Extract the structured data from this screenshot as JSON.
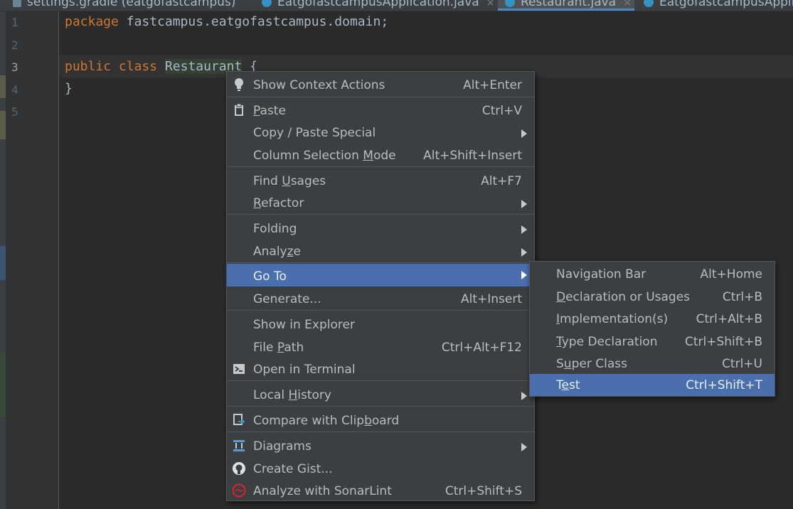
{
  "tabs": [
    {
      "label": "settings.gradle (eatgofastcampus)"
    },
    {
      "label": "EatgofastcampusApplication.java"
    },
    {
      "label": "Restaurant.java"
    },
    {
      "label": "EatgofastcampusAppli"
    }
  ],
  "editor": {
    "line_numbers": [
      "1",
      "2",
      "3",
      "4",
      "5"
    ],
    "line1": {
      "kw": "package",
      "rest": " fastcampus.eatgofastcampus.domain;"
    },
    "line3": {
      "kw1": "public",
      "kw2": "class",
      "classname": "Restaurant",
      "brace": " {"
    },
    "line4": "}"
  },
  "context_menu": {
    "show_context_actions": {
      "label": "Show Context Actions",
      "shortcut": "Alt+Enter"
    },
    "paste": {
      "pre": "",
      "ul": "P",
      "post": "aste",
      "shortcut": "Ctrl+V"
    },
    "copy_paste_special": {
      "label": "Copy / Paste Special"
    },
    "column_selection_mode": {
      "pre": "Column Selection ",
      "ul": "M",
      "post": "ode",
      "shortcut": "Alt+Shift+Insert"
    },
    "find_usages": {
      "pre": "Find ",
      "ul": "U",
      "post": "sages",
      "shortcut": "Alt+F7"
    },
    "refactor": {
      "pre": "",
      "ul": "R",
      "post": "efactor"
    },
    "folding": {
      "label": "Folding"
    },
    "analyze": {
      "pre": "Analy",
      "ul": "z",
      "post": "e"
    },
    "go_to": {
      "label": "Go To"
    },
    "generate": {
      "label": "Generate...",
      "shortcut": "Alt+Insert"
    },
    "show_in_explorer": {
      "label": "Show in Explorer"
    },
    "file_path": {
      "pre": "File ",
      "ul": "P",
      "post": "ath",
      "shortcut": "Ctrl+Alt+F12"
    },
    "open_in_terminal": {
      "label": "Open in Terminal"
    },
    "local_history": {
      "pre": "Local ",
      "ul": "H",
      "post": "istory"
    },
    "compare_with_clipboard": {
      "pre": "Compare with Clip",
      "ul": "b",
      "post": "oard"
    },
    "diagrams": {
      "label": "Diagrams"
    },
    "create_gist": {
      "label": "Create Gist..."
    },
    "analyze_sonarlint": {
      "label": "Analyze with SonarLint",
      "shortcut": "Ctrl+Shift+S"
    }
  },
  "goto_submenu": {
    "navigation_bar": {
      "label": "Navigation Bar",
      "shortcut": "Alt+Home"
    },
    "declaration": {
      "pre": "",
      "ul": "D",
      "post": "eclaration or Usages",
      "shortcut": "Ctrl+B"
    },
    "implementation": {
      "pre": "",
      "ul": "I",
      "post": "mplementation(s)",
      "shortcut": "Ctrl+Alt+B"
    },
    "type_declaration": {
      "pre": "",
      "ul": "T",
      "post": "ype Declaration",
      "shortcut": "Ctrl+Shift+B"
    },
    "super_class": {
      "pre": "S",
      "ul": "u",
      "post": "per Class",
      "shortcut": "Ctrl+U"
    },
    "test": {
      "pre": "T",
      "ul": "e",
      "post": "st",
      "shortcut": "Ctrl+Shift+T"
    }
  },
  "colors": {
    "selection": "#4b6eaf",
    "menu_bg": "#3c3f41",
    "editor_bg": "#2b2b2b",
    "keyword": "#cc7832"
  }
}
